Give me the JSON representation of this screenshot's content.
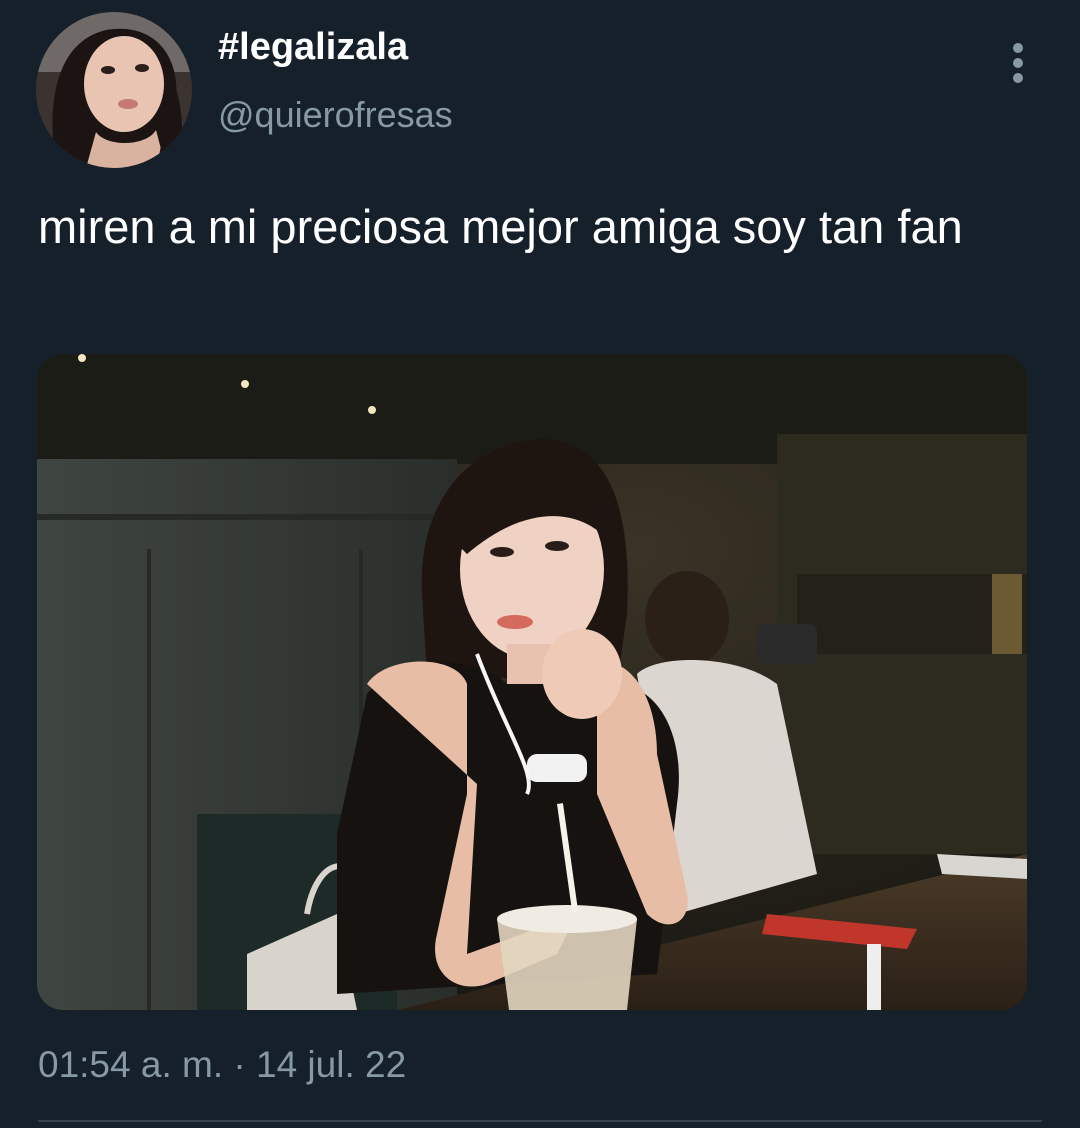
{
  "tweet": {
    "display_name": "#legalizala",
    "handle": "@quierofresas",
    "text": "miren a mi preciosa mejor amiga soy tan fan",
    "timestamp": "01:54 a. m. · 14 jul. 22",
    "avatar_icon": "profile-photo",
    "more_icon": "vertical-ellipsis-icon"
  },
  "colors": {
    "background": "#15202b",
    "text_primary": "#ffffff",
    "text_secondary": "#8899a6",
    "divider": "#38444d"
  }
}
